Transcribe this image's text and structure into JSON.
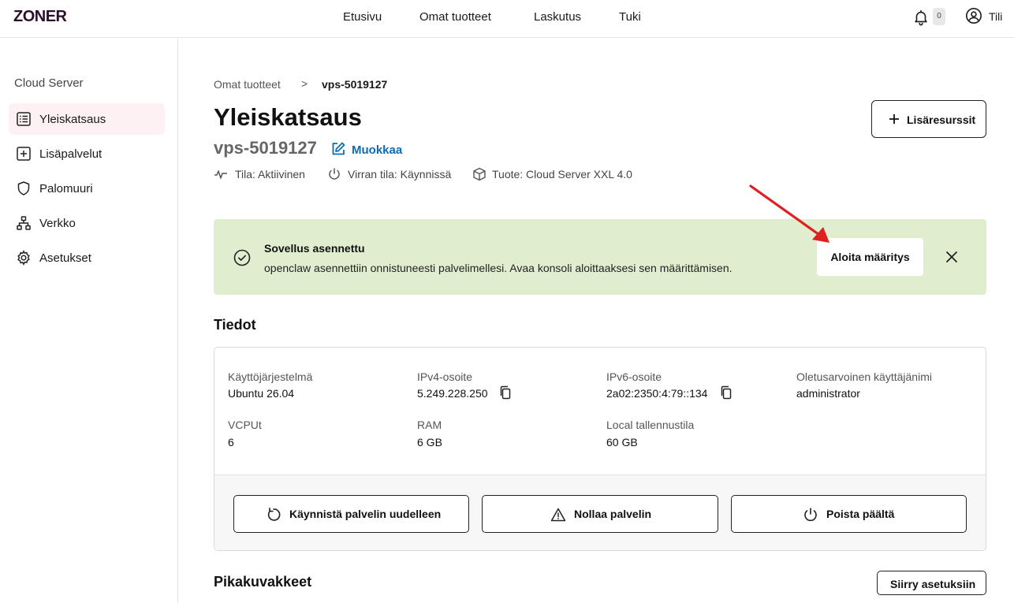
{
  "app": {
    "logo": "ZONER"
  },
  "topnav": {
    "items": [
      "Etusivu",
      "Omat tuotteet",
      "Laskutus",
      "Tuki"
    ],
    "notification_count": "0",
    "account_label": "Tili"
  },
  "sidebar": {
    "title": "Cloud Server",
    "items": [
      {
        "label": "Yleiskatsaus",
        "icon": "list-icon",
        "active": true
      },
      {
        "label": "Lisäpalvelut",
        "icon": "plus-square-icon",
        "active": false
      },
      {
        "label": "Palomuuri",
        "icon": "shield-icon",
        "active": false
      },
      {
        "label": "Verkko",
        "icon": "network-icon",
        "active": false
      },
      {
        "label": "Asetukset",
        "icon": "gear-icon",
        "active": false
      }
    ]
  },
  "breadcrumb": {
    "parent": "Omat tuotteet",
    "separator": ">",
    "current": "vps-5019127"
  },
  "header": {
    "title": "Yleiskatsaus",
    "server_name": "vps-5019127",
    "edit_label": "Muokkaa",
    "add_resources_label": "Lisäresurssit"
  },
  "meta": {
    "status": "Tila: Aktiivinen",
    "power": "Virran tila: Käynnissä",
    "product": "Tuote: Cloud Server XXL 4.0"
  },
  "banner": {
    "title": "Sovellus asennettu",
    "text": "openclaw asennettiin onnistuneesti palvelimellesi. Avaa konsoli aloittaaksesi sen määrittämisen.",
    "action_label": "Aloita määritys",
    "color": "#e0eecf"
  },
  "details": {
    "section_title": "Tiedot",
    "fields": {
      "os": {
        "label": "Käyttöjärjestelmä",
        "value": "Ubuntu 26.04"
      },
      "ipv4": {
        "label": "IPv4-osoite",
        "value": "5.249.228.250"
      },
      "ipv6": {
        "label": "IPv6-osoite",
        "value": "2a02:2350:4:79::134"
      },
      "user": {
        "label": "Oletusarvoinen käyttäjänimi",
        "value": "administrator"
      },
      "vcpu": {
        "label": "VCPUt",
        "value": "6"
      },
      "ram": {
        "label": "RAM",
        "value": "6 GB"
      },
      "storage": {
        "label": "Local tallennustila",
        "value": "60 GB"
      }
    },
    "actions": {
      "restart": "Käynnistä palvelin uudelleen",
      "reset": "Nollaa palvelin",
      "poweroff": "Poista päältä"
    }
  },
  "shortcuts": {
    "section_title": "Pikakuvakkeet",
    "settings_button": "Siirry asetuksiin"
  },
  "colors": {
    "accent_link": "#0f6bb0",
    "annotation_arrow": "#e02020",
    "active_sidebar_bg": "#fdf1f3"
  }
}
